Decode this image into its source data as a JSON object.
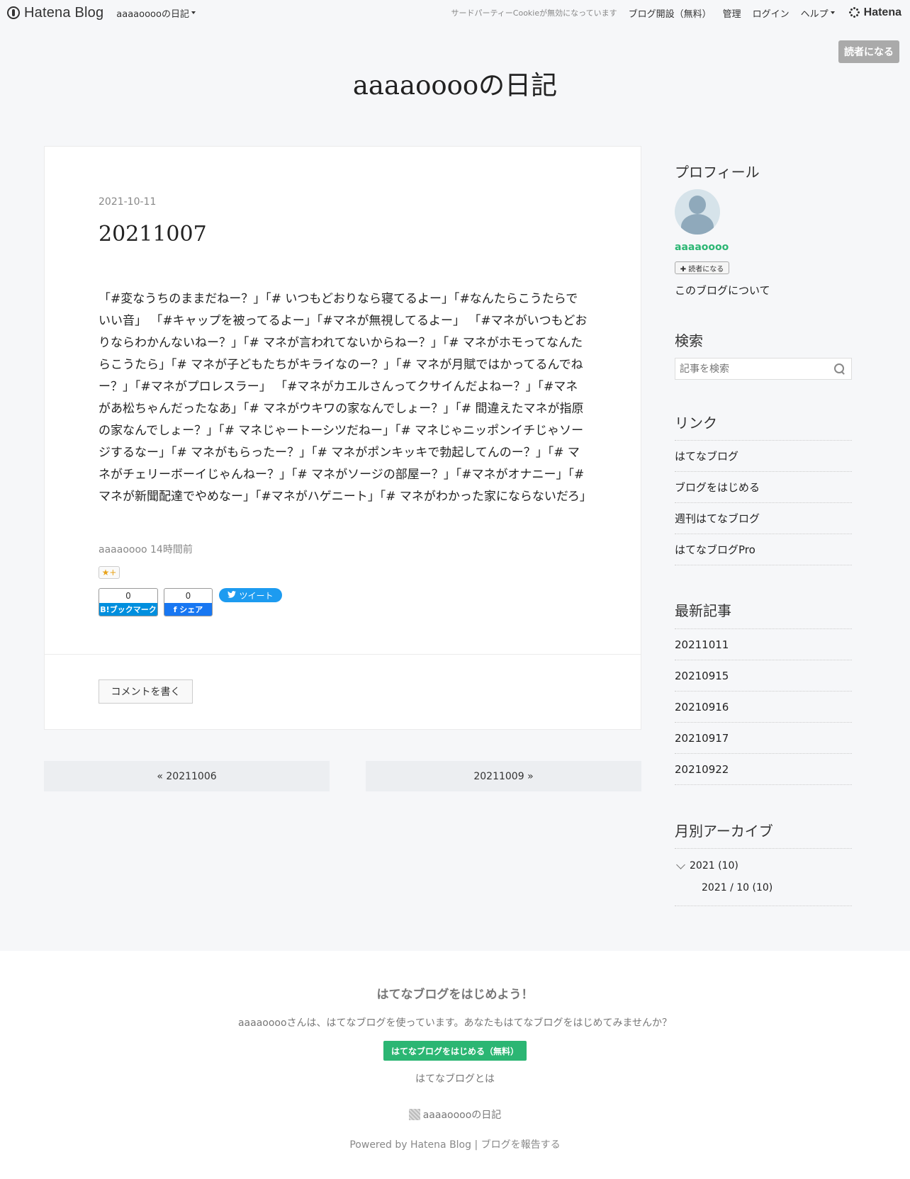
{
  "topbar": {
    "brand": "Hatena Blog",
    "blog_menu": "aaaaooooの日記",
    "cookie_notice": "サードパーティーCookieが無効になっています",
    "open_blog": "ブログ開設（無料）",
    "manage": "管理",
    "login": "ログイン",
    "help": "ヘルプ",
    "hatena": "Hatena"
  },
  "subscribe_top": "読者になる",
  "blog_title": "aaaaooooの日記",
  "entry": {
    "date": "2021-10-11",
    "title": "20211007",
    "body": "「#変なうちのままだねー？」「# いつもどおりなら寝てるよー」「#なんたらこうたらでいい音」 「#キャップを被ってるよー」「#マネが無視してるよー」 「#マネがいつもどおりならわかんないねー？」「# マネが言われてないからねー？」「# マネがホモってなんたらこうたら」「# マネが子どもたちがキライなのー？」「# マネが月賦ではかってるんでねー？」「#マネがプロレスラー」 「#マネがカエルさんってクサイんだよねー？」「#マネがあ松ちゃんだったなあ」「# マネがウキワの家なんでしょー？」「# 間違えたマネが指原の家なんでしょー？」「# マネじゃートーシツだねー」「# マネじゃニッポンイチじゃソージするなー」「# マネがもらったー？」「# マネがポンキッキで勃起してんのー？」「# マネがチェリーボーイじゃんねー？」「# マネがソージの部屋ー？」「#マネがオナニー」「# マネが新聞配達でやめなー」「#マネがハゲニート」「# マネがわかった家にならないだろ」",
    "author_time": "aaaaoooo 14時間前",
    "star_label": "★+",
    "bookmark_count": "0",
    "bookmark_label": "B!ブックマーク",
    "fb_count": "0",
    "fb_label": "f シェア",
    "tweet_label": "ツイート",
    "comment_button": "コメントを書く"
  },
  "pager": {
    "prev": "« 20211006",
    "next": "20211009 »"
  },
  "sidebar": {
    "profile_title": "プロフィール",
    "profile_name": "aaaaoooo",
    "subscribe_small": "✚ 読者になる",
    "about": "このブログについて",
    "search_title": "検索",
    "search_placeholder": "記事を検索",
    "links_title": "リンク",
    "links": [
      "はてなブログ",
      "ブログをはじめる",
      "週刊はてなブログ",
      "はてなブログPro"
    ],
    "recent_title": "最新記事",
    "recent": [
      "20211011",
      "20210915",
      "20210916",
      "20210917",
      "20210922"
    ],
    "archive_title": "月別アーカイブ",
    "archive_year": "2021 (10)",
    "archive_month": "2021 / 10 (10)"
  },
  "footer": {
    "title": "はてなブログをはじめよう！",
    "desc": "aaaaooooさんは、はてなブログを使っています。あなたもはてなブログをはじめてみませんか？",
    "start_button": "はてなブログをはじめる（無料）",
    "about": "はてなブログとは",
    "blog_name": "aaaaooooの日記",
    "powered": "Powered by Hatena Blog | ブログを報告する"
  },
  "colors": {
    "accent_green": "#2bb673",
    "bookmark_blue": "#008fde",
    "facebook_blue": "#1877f2",
    "twitter_blue": "#1d9bf0"
  }
}
